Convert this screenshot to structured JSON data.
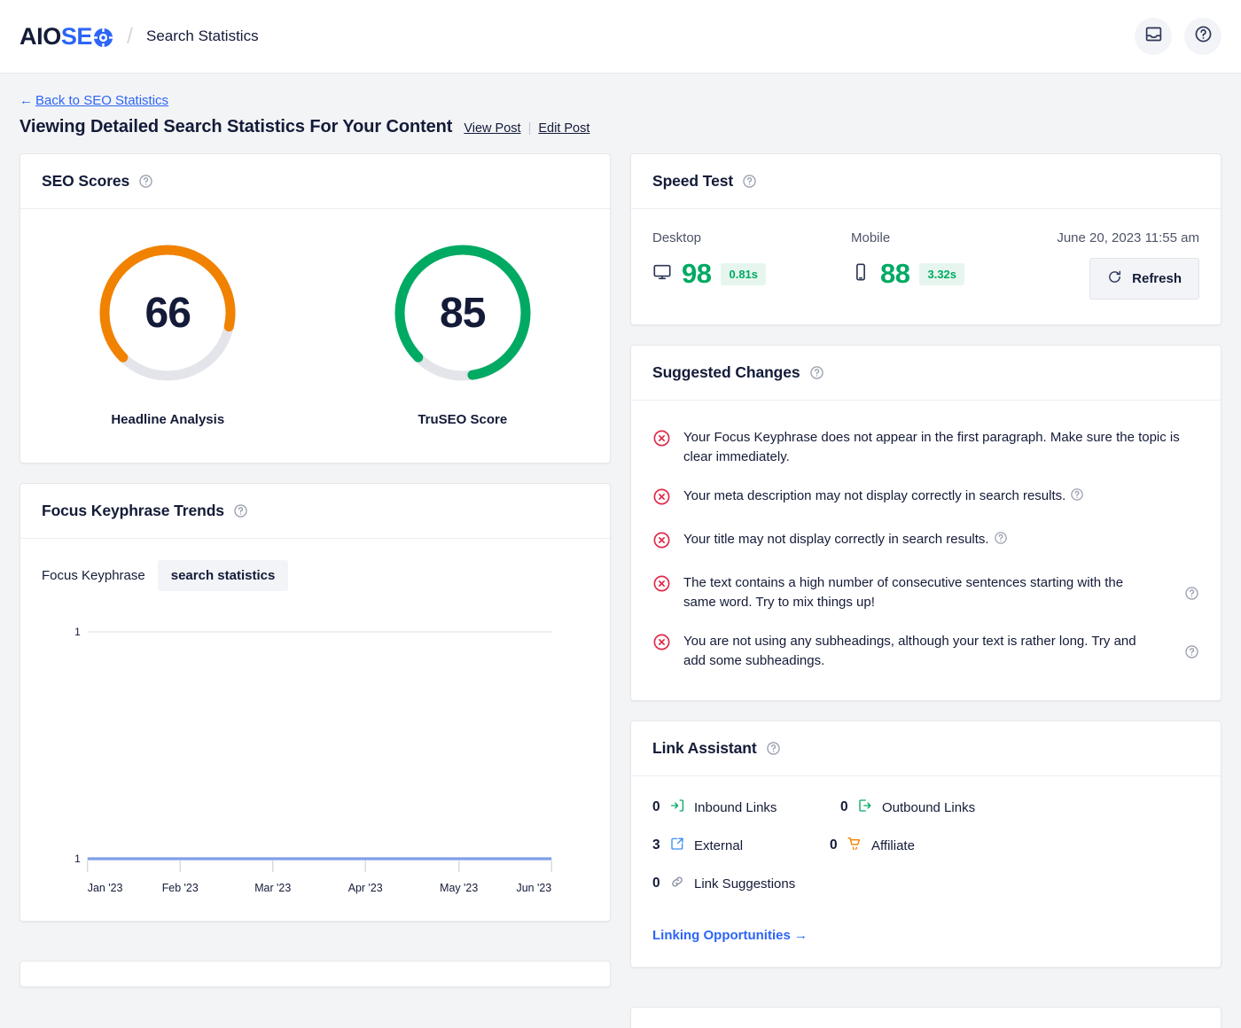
{
  "brand": {
    "logo_aio": "AIO",
    "logo_seo": "SE",
    "logo_gear_icon": "gear-o-icon",
    "separator": "/",
    "section": "Search Statistics"
  },
  "topbar": {
    "notifications_icon": "inbox-icon",
    "help_icon": "question-circle-icon"
  },
  "page": {
    "back_arrow": "←",
    "back_label": "Back to SEO Statistics",
    "title": "Viewing Detailed Search Statistics For Your Content",
    "view_post": "View Post",
    "link_divider": "|",
    "edit_post": "Edit Post"
  },
  "seo_scores": {
    "title": "SEO Scores",
    "help_icon": "question-circle-icon",
    "gauges": [
      {
        "value": "66",
        "label": "Headline Analysis",
        "color": "#f18200",
        "track": "#e3e5ea",
        "percent": 66
      },
      {
        "value": "85",
        "label": "TruSEO Score",
        "color": "#00aa63",
        "track": "#e3e5ea",
        "percent": 85
      }
    ]
  },
  "keyphrase_trends": {
    "title": "Focus Keyphrase Trends",
    "help_icon": "question-circle-icon",
    "field_label": "Focus Keyphrase",
    "keyphrase": "search statistics"
  },
  "chart_data": {
    "type": "line",
    "title": "Focus Keyphrase Trends",
    "categories": [
      "Jan '23",
      "Feb '23",
      "Mar '23",
      "Apr '23",
      "May '23",
      "Jun '23"
    ],
    "series": [
      {
        "name": "search statistics",
        "values": [
          1,
          1,
          1,
          1,
          1,
          1
        ],
        "color": "#7e9fe8"
      }
    ],
    "xlabel": "",
    "ylabel": "",
    "ytick_labels": [
      "1",
      "1"
    ],
    "ylim": [
      1,
      1
    ],
    "grid": true,
    "gridline_color": "#e8e8eb",
    "legend": "none"
  },
  "speed_test": {
    "title": "Speed Test",
    "help_icon": "question-circle-icon",
    "desktop": {
      "label": "Desktop",
      "icon": "desktop-monitor-icon",
      "score": "98",
      "time": "0.81s"
    },
    "mobile": {
      "label": "Mobile",
      "icon": "mobile-phone-icon",
      "score": "88",
      "time": "3.32s"
    },
    "timestamp": "June 20, 2023 11:55 am",
    "refresh_label": "Refresh",
    "refresh_icon": "refresh-icon",
    "score_color": "#00aa63",
    "pill_bg": "#e6f6ee"
  },
  "suggested_changes": {
    "title": "Suggested Changes",
    "help_icon": "question-circle-icon",
    "status_icon": "error-circle-x-icon",
    "items": [
      {
        "text": "Your Focus Keyphrase does not appear in the first paragraph. Make sure the topic is clear immediately.",
        "inline_help": false,
        "right_help": false
      },
      {
        "text": "Your meta description may not display correctly in search results.",
        "inline_help": true,
        "right_help": false
      },
      {
        "text": "Your title may not display correctly in search results.",
        "inline_help": true,
        "right_help": false
      },
      {
        "text": "The text contains a high number of consecutive sentences starting with the same word. Try to mix things up!",
        "inline_help": false,
        "right_help": true
      },
      {
        "text": "You are not using any subheadings, although your text is rather long. Try and add some subheadings.",
        "inline_help": false,
        "right_help": true
      }
    ]
  },
  "link_assistant": {
    "title": "Link Assistant",
    "help_icon": "question-circle-icon",
    "stats": [
      {
        "count": "0",
        "label": "Inbound Links",
        "icon": "inbound-link-icon",
        "color": "#00aa63"
      },
      {
        "count": "0",
        "label": "Outbound Links",
        "icon": "outbound-link-icon",
        "color": "#00aa63"
      },
      {
        "count": "3",
        "label": "External",
        "icon": "external-link-icon",
        "color": "#2c65f7"
      },
      {
        "count": "0",
        "label": "Affiliate",
        "icon": "shopping-cart-icon",
        "color": "#f18200"
      },
      {
        "count": "0",
        "label": "Link Suggestions",
        "icon": "chain-link-icon",
        "color": "#8c91a4"
      }
    ],
    "cta": "Linking Opportunities →"
  }
}
